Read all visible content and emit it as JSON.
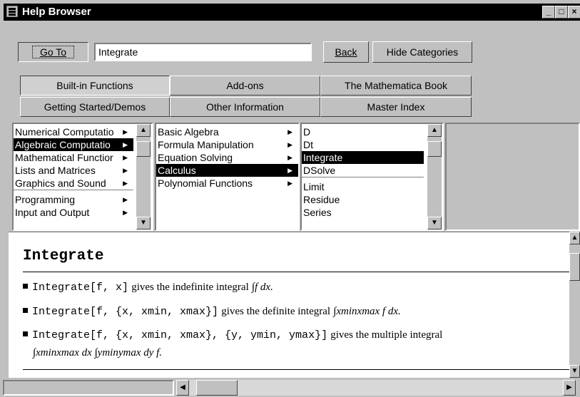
{
  "window": {
    "title": "Help Browser",
    "controls": [
      "_",
      "□",
      "×"
    ]
  },
  "toolbar": {
    "goto_label": "Go To",
    "search_value": "Integrate",
    "back_label": "Back",
    "hide_categories_label": "Hide Categories"
  },
  "categories": [
    {
      "label": "Built-in Functions"
    },
    {
      "label": "Add-ons"
    },
    {
      "label": "The Mathematica Book"
    },
    {
      "label": "Getting Started/Demos"
    },
    {
      "label": "Other Information"
    },
    {
      "label": "Master Index"
    }
  ],
  "list1": [
    "Numerical Computatio",
    "Algebraic Computatio",
    "Mathematical Functior",
    "Lists and Matrices",
    "Graphics and Sound",
    "Programming",
    "Input and Output"
  ],
  "list2": [
    "Basic Algebra",
    "Formula Manipulation",
    "Equation Solving",
    "Calculus",
    "Polynomial Functions"
  ],
  "list3": [
    "D",
    "Dt",
    "Integrate",
    "DSolve",
    "Limit",
    "Residue",
    "Series"
  ],
  "doc": {
    "heading": "Integrate",
    "line1": {
      "code": "Integrate[f, x]",
      "text": "gives the indefinite integral",
      "math": "∫f dx."
    },
    "line2": {
      "code": "Integrate[f, {x, xmin, xmax}]",
      "text": "gives the definite integral",
      "math": "∫xminxmax f dx."
    },
    "line3": {
      "code": "Integrate[f, {x, xmin, xmax}, {y, ymin, ymax}]",
      "text": "gives the multiple integral",
      "math": "∫xminxmax dx ∫yminymax dy f."
    }
  },
  "scroll": {
    "list1": {
      "top": 0.05,
      "size": 0.2
    },
    "list3": {
      "top": 0.05,
      "size": 0.2
    },
    "doc": {
      "top": 0.07,
      "size": 0.23
    },
    "h": {
      "left": 0.02,
      "size": 0.11
    }
  }
}
